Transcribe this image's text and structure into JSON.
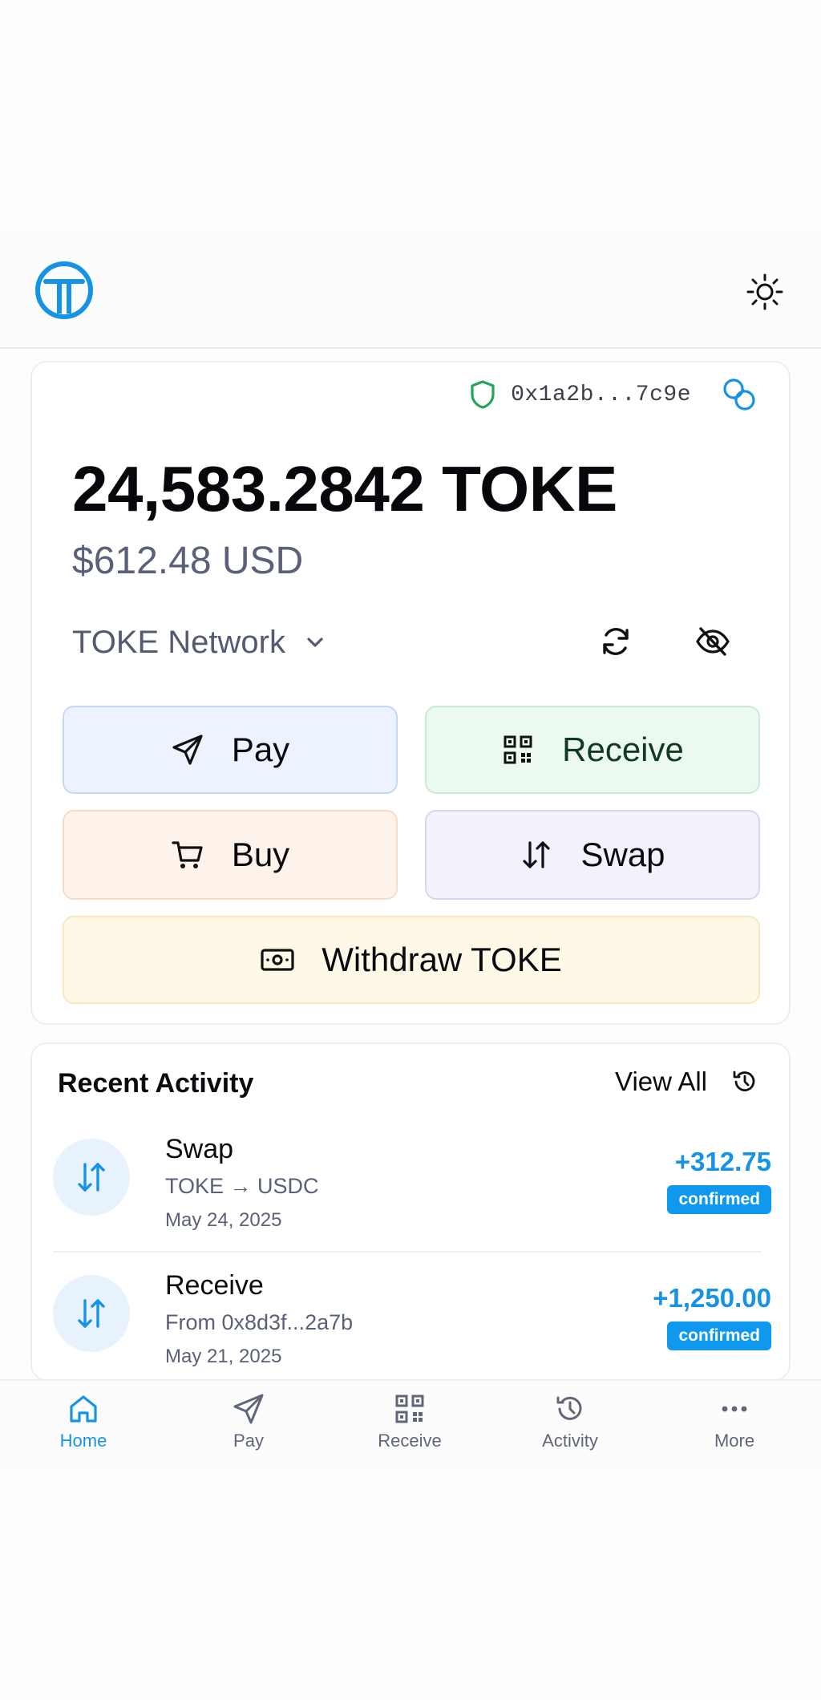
{
  "header": {
    "logo_icon": "toke-logo-icon",
    "theme_icon": "sun-icon"
  },
  "wallet": {
    "address": "0x1a2b...7c9e",
    "balance": "24,583.2842 TOKE",
    "balance_usd": "$612.48 USD",
    "network": "TOKE Network"
  },
  "actions": {
    "pay": "Pay",
    "receive": "Receive",
    "buy": "Buy",
    "swap": "Swap",
    "withdraw": "Withdraw TOKE"
  },
  "activity": {
    "title": "Recent Activity",
    "view_all": "View All",
    "items": [
      {
        "title": "Swap",
        "subtitle": "TOKE → USDC",
        "date": "May 24, 2025",
        "amount": "+312.75",
        "status": "confirmed"
      },
      {
        "title": "Receive",
        "subtitle": "From 0x8d3f...2a7b",
        "date": "May 21, 2025",
        "amount": "+1,250.00",
        "status": "confirmed"
      }
    ]
  },
  "nav": {
    "home": "Home",
    "pay": "Pay",
    "receive": "Receive",
    "activity": "Activity",
    "more": "More"
  },
  "colors": {
    "accent": "#1793e6",
    "success": "#22a55a",
    "badge": "#0e99ee"
  }
}
